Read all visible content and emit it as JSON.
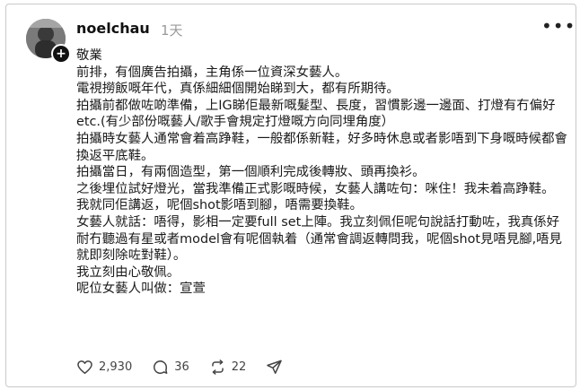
{
  "post": {
    "username": "noelchau",
    "time_ago": "1天",
    "more_icon": "more-horizontal-icon",
    "paragraphs": [
      "敬業",
      "前排，有個廣告拍攝，主角係一位資深女藝人。",
      "電視撈飯嘅年代，真係細細個開始睇到大，都有所期待。",
      "拍攝前都做咗啲準備，上IG睇佢最新嘅髮型、長度，習慣影邊一邊面、打燈有冇偏好etc.(有少部份嘅藝人/歌手會規定打燈嘅方向同埋角度）",
      "拍攝時女藝人通常會着高踭鞋，一般都係新鞋，好多時休息或者影唔到下身嘅時候都會換返平底鞋。",
      "拍攝當日，有兩個造型，第一個順利完成後轉妝、頭再換衫。",
      "之後埋位試好燈光，當我準備正式影嘅時候，女藝人講咗句：咪住！我未着高踭鞋。",
      "我就同佢講返，呢個shot影唔到腳，唔需要換鞋。",
      "女藝人就話：唔得，影相一定要full set上陣。我立刻佩佢呢句說話打動咗，我真係好耐冇聽過有星或者model會有呢個執着（通常會調返轉問我，呢個shot見唔見腳,唔見就即刻除咗對鞋）。",
      "我立刻由心敬佩。",
      "呢位女藝人叫做：宣萱"
    ]
  },
  "actions": {
    "likes": "2,930",
    "comments": "36",
    "reposts": "22"
  }
}
